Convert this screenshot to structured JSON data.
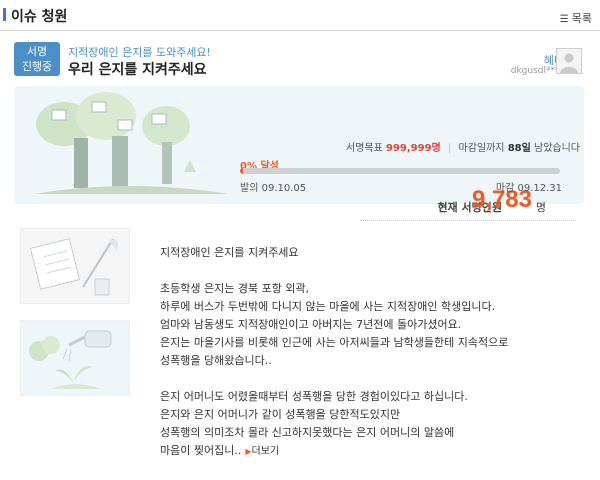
{
  "header": {
    "title": "이슈 청원",
    "list_label": "목록",
    "list_icon": "list-icon"
  },
  "petition": {
    "badge_line1": "서명",
    "badge_line2": "진행중",
    "subtitle": "지적장애인 은지를 도와주세요!",
    "title": "우리 은지를 지켜주세요",
    "author": "혜니",
    "user_id": "dkgusdl****"
  },
  "stats": {
    "current_label": "현재 서명인원",
    "current_value": "9,783",
    "unit": "명",
    "goal_label": "서명목표",
    "goal_value": "999,999명",
    "deadline_pre": "마감일까지",
    "days_left": "88일",
    "deadline_post": "남았습니다",
    "percent_label": "0% 달성",
    "progress_fraction": 0.0098,
    "start_label": "발의",
    "start_date": "09.10.05",
    "end_label": "마감",
    "end_date": "09.12.31"
  },
  "body": {
    "heading": "지적장애인 은지를 지켜주세요",
    "p1": [
      "초등학생 은지는 경북 포항 외곽,",
      "하루에 버스가 두번밖에 다니지 않는 마을에 사는 지적장애인 학생입니다.",
      "엄마와 남동생도 지적장애인이고 아버지는 7년전에 돌아가셨어요.",
      "은지는 마을기사를 비롯해 인근에 사는 아저씨들과 남학생들한테 지속적으로",
      "성폭행을 당해왔습니다.."
    ],
    "p2": [
      "은지 어머니도 어렸을때부터 성폭행을 당한 경험이있다고 하십니다.",
      "은지와 은지 어머니가 같이 성폭행을 당한적도있지만",
      "성폭행의 의미조차 몰라 신고하지못했다는 은지 어머니의 말씀에",
      "마음이 찢어집니.."
    ],
    "more_label": "더보기"
  },
  "colors": {
    "accent": "#4a8fc7",
    "highlight": "#f05a24",
    "panel_bg": "#eef6f9"
  }
}
